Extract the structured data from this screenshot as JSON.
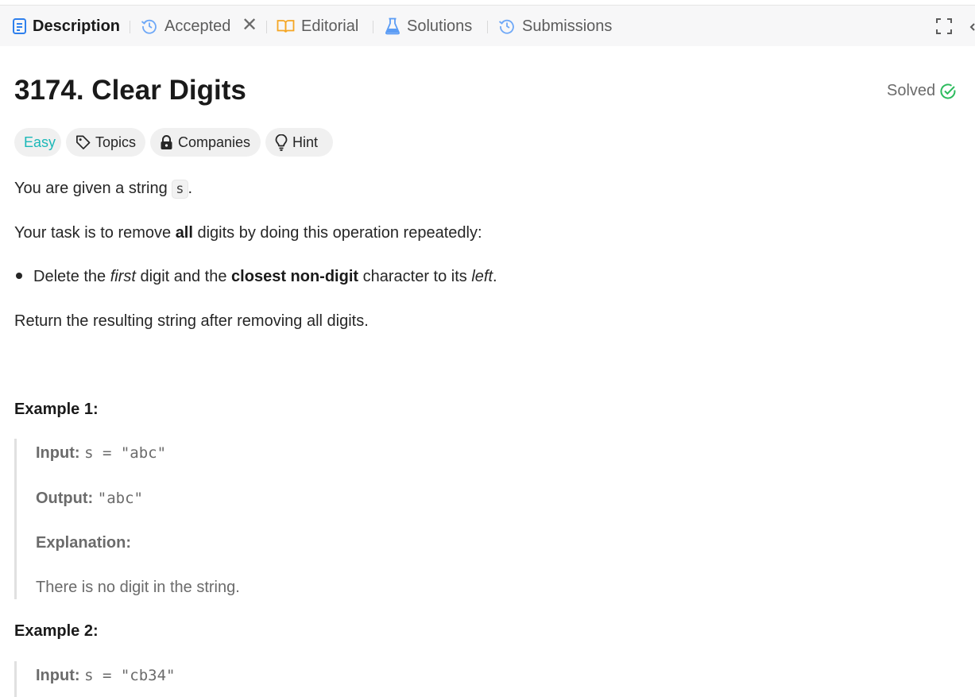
{
  "tabs": {
    "description": "Description",
    "accepted": "Accepted",
    "close": "✕",
    "editorial": "Editorial",
    "solutions": "Solutions",
    "submissions": "Submissions"
  },
  "problem": {
    "title": "3174. Clear Digits",
    "status": "Solved"
  },
  "chips": {
    "difficulty": "Easy",
    "topics": "Topics",
    "companies": "Companies",
    "hint": "Hint"
  },
  "description": {
    "p1_pre": "You are given a string ",
    "p1_code": "s",
    "p1_post": ".",
    "p2_pre": "Your task is to remove ",
    "p2_bold": "all",
    "p2_post": " digits by doing this operation repeatedly:",
    "b1_a": "Delete the ",
    "b1_em1": "first",
    "b1_b": " digit and the ",
    "b1_bold": "closest non-digit",
    "b1_c": " character to its ",
    "b1_em2": "left",
    "b1_d": ".",
    "p3": "Return the resulting string after removing all digits."
  },
  "examples": {
    "ex1": {
      "title": "Example 1:",
      "input_label": "Input:",
      "input_value": "s = \"abc\"",
      "output_label": "Output:",
      "output_value": "\"abc\"",
      "explanation_label": "Explanation:",
      "explanation_text": "There is no digit in the string."
    },
    "ex2": {
      "title": "Example 2:",
      "input_label": "Input:",
      "input_value": "s = \"cb34\""
    }
  },
  "colors": {
    "accent_blue": "#2f80ed",
    "easy_teal": "#1cb8b8",
    "solved_green": "#2cbb5d",
    "editorial_orange": "#f5a623"
  }
}
